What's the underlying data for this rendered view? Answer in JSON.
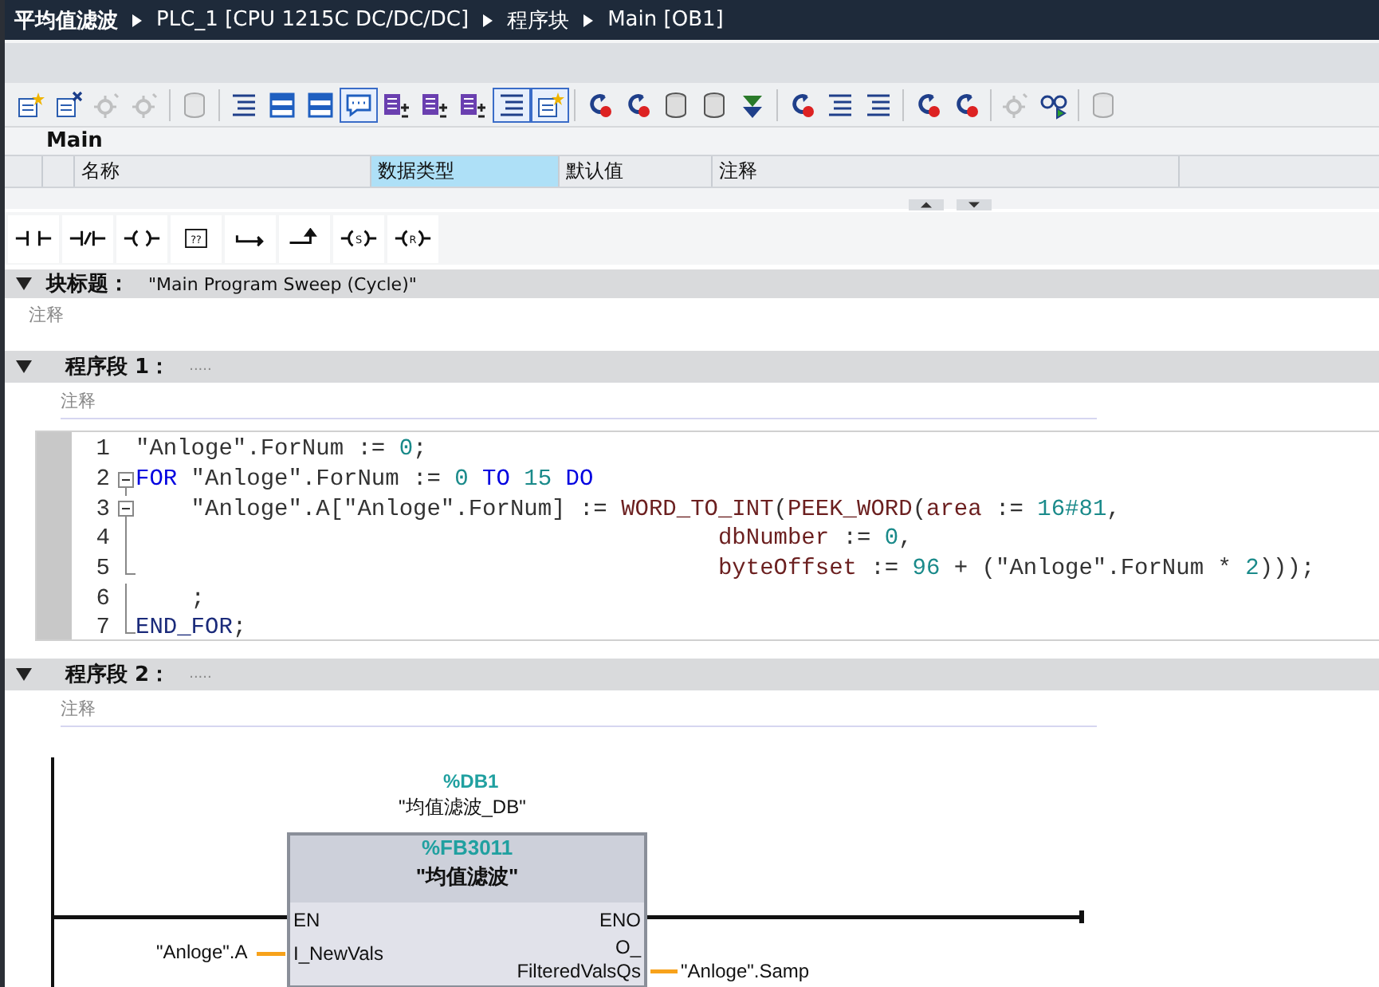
{
  "breadcrumb": [
    {
      "text": "平均值滤波"
    },
    {
      "text": "PLC_1 [CPU 1215C DC/DC/DC]"
    },
    {
      "text": "程序块"
    },
    {
      "text": "Main [OB1]"
    }
  ],
  "toolbar": [
    [
      {
        "kind": "star-doc",
        "selected": false,
        "disabled": false
      },
      {
        "kind": "cross-doc",
        "selected": false,
        "disabled": false
      },
      {
        "kind": "gear",
        "selected": false,
        "disabled": true
      },
      {
        "kind": "gear",
        "selected": false,
        "disabled": true
      }
    ],
    [
      {
        "kind": "cylinder",
        "selected": false,
        "disabled": true
      }
    ],
    [
      {
        "kind": "lines",
        "selected": false,
        "disabled": false
      },
      {
        "kind": "window",
        "selected": false,
        "disabled": false
      },
      {
        "kind": "window",
        "selected": false,
        "disabled": false
      },
      {
        "kind": "bubble",
        "selected": true,
        "disabled": false
      },
      {
        "kind": "stack",
        "selected": false,
        "disabled": false
      },
      {
        "kind": "stack",
        "selected": false,
        "disabled": false
      },
      {
        "kind": "stack",
        "selected": false,
        "disabled": false
      },
      {
        "kind": "lines",
        "selected": true,
        "disabled": false
      },
      {
        "kind": "star-doc",
        "selected": true,
        "disabled": false
      }
    ],
    [
      {
        "kind": "curve-arrow",
        "selected": false,
        "disabled": false
      },
      {
        "kind": "curve-arrow",
        "selected": false,
        "disabled": false
      },
      {
        "kind": "cylinder",
        "selected": false,
        "disabled": false
      },
      {
        "kind": "cylinder",
        "selected": false,
        "disabled": false
      },
      {
        "kind": "down-arrow",
        "selected": false,
        "disabled": false
      }
    ],
    [
      {
        "kind": "curve-arrow",
        "selected": false,
        "disabled": false
      },
      {
        "kind": "lines",
        "selected": false,
        "disabled": false
      },
      {
        "kind": "lines",
        "selected": false,
        "disabled": false
      }
    ],
    [
      {
        "kind": "curve-arrow",
        "selected": false,
        "disabled": false
      },
      {
        "kind": "curve-arrow",
        "selected": false,
        "disabled": false
      }
    ],
    [
      {
        "kind": "gear",
        "selected": false,
        "disabled": true
      },
      {
        "kind": "glasses",
        "selected": false,
        "disabled": false
      }
    ],
    [
      {
        "kind": "cylinder",
        "selected": false,
        "disabled": true
      }
    ]
  ],
  "interface": {
    "title": "Main",
    "columns": [
      {
        "label": "名称",
        "selected": false
      },
      {
        "label": "数据类型",
        "selected": true
      },
      {
        "label": "默认值",
        "selected": false
      },
      {
        "label": "注释",
        "selected": false
      }
    ]
  },
  "ladder_tools": [
    {
      "kind": "contact"
    },
    {
      "kind": "negated-contact"
    },
    {
      "kind": "coil"
    },
    {
      "kind": "box",
      "label": "??"
    },
    {
      "kind": "branch-open"
    },
    {
      "kind": "branch-close"
    },
    {
      "kind": "letter-coil",
      "label": "S"
    },
    {
      "kind": "letter-coil",
      "label": "R"
    }
  ],
  "block": {
    "label": "块标题：",
    "title": "\"Main Program Sweep (Cycle)\"",
    "expanded": true,
    "comment": "注释"
  },
  "networks": [
    {
      "label": "程序段 1：",
      "dots": ".....",
      "expanded": true,
      "comment": "注释",
      "kind": "scl",
      "code": [
        {
          "number": "1",
          "kind": "plain",
          "tokens": [
            {
              "kind": "text",
              "text": "\"Anloge\".ForNum := "
            },
            {
              "kind": "number",
              "text": "0"
            },
            {
              "kind": "text",
              "text": ";"
            }
          ]
        },
        {
          "number": "2",
          "kind": "fold-start",
          "tokens": [
            {
              "kind": "keyword",
              "text": "FOR"
            },
            {
              "kind": "text",
              "text": " \"Anloge\".ForNum := "
            },
            {
              "kind": "number",
              "text": "0"
            },
            {
              "kind": "keyword",
              "text": " TO "
            },
            {
              "kind": "number",
              "text": "15"
            },
            {
              "kind": "keyword",
              "text": " DO"
            }
          ]
        },
        {
          "number": "3",
          "kind": "fold-start",
          "tokens": [
            {
              "kind": "text",
              "text": "    \"Anloge\".A[\"Anloge\".ForNum] := "
            },
            {
              "kind": "function",
              "text": "WORD_TO_INT"
            },
            {
              "kind": "text",
              "text": "("
            },
            {
              "kind": "function",
              "text": "PEEK_WORD"
            },
            {
              "kind": "text",
              "text": "("
            },
            {
              "kind": "function",
              "text": "area"
            },
            {
              "kind": "text",
              "text": " := "
            },
            {
              "kind": "number",
              "text": "16#81"
            },
            {
              "kind": "text",
              "text": ","
            }
          ]
        },
        {
          "number": "4",
          "kind": "fold-inner",
          "tokens": [
            {
              "kind": "function",
              "text": "                                          dbNumber"
            },
            {
              "kind": "text",
              "text": " := "
            },
            {
              "kind": "number",
              "text": "0"
            },
            {
              "kind": "text",
              "text": ","
            }
          ]
        },
        {
          "number": "5",
          "kind": "fold-end",
          "tokens": [
            {
              "kind": "function",
              "text": "                                          byteOffset"
            },
            {
              "kind": "text",
              "text": " := "
            },
            {
              "kind": "number",
              "text": "96"
            },
            {
              "kind": "text",
              "text": " + (\"Anloge\".ForNum * "
            },
            {
              "kind": "number",
              "text": "2"
            },
            {
              "kind": "text",
              "text": ")));"
            }
          ]
        },
        {
          "number": "6",
          "kind": "fold-inner",
          "tokens": [
            {
              "kind": "text",
              "text": "    ;"
            }
          ]
        },
        {
          "number": "7",
          "kind": "fold-end",
          "tokens": [
            {
              "kind": "end",
              "text": "END_FOR"
            },
            {
              "kind": "text",
              "text": ";"
            }
          ]
        }
      ]
    },
    {
      "label": "程序段 2：",
      "dots": ".....",
      "expanded": true,
      "comment": "注释",
      "kind": "ladder",
      "ladder": {
        "instance_address": "%DB1",
        "instance_name": "\"均值滤波_DB\"",
        "block_address": "%FB3011",
        "block_name": "\"均值滤波\"",
        "enable_in": "EN",
        "enable_out": "ENO",
        "input": {
          "pin": "I_NewVals",
          "operand": "\"Anloge\".A"
        },
        "output": {
          "pin_lines": [
            "O_",
            "FilteredValsQs"
          ],
          "operand": "\"Anloge\".Samp"
        }
      }
    }
  ]
}
